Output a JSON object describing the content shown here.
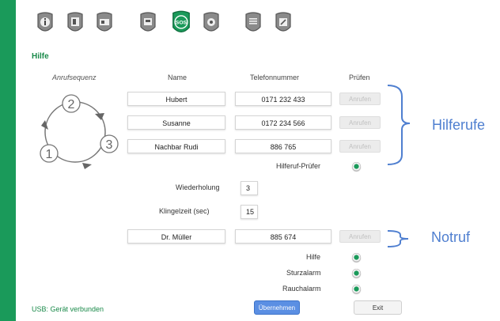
{
  "toolbar": {
    "icons": [
      "info-icon",
      "phone-book-icon",
      "radio-icon",
      "device-icon",
      "sos-icon",
      "settings-icon",
      "list-icon",
      "edit-icon"
    ],
    "sos_label": "SOS",
    "active_color": "#1a9a5a"
  },
  "page": {
    "title": "Hilfe"
  },
  "headers": {
    "sequence": "Anrufsequenz",
    "name": "Name",
    "phone": "Telefonnummer",
    "test": "Prüfen"
  },
  "sequence_nodes": [
    "2",
    "3",
    "1"
  ],
  "contacts": [
    {
      "name": "Hubert",
      "phone": "0171 232 433",
      "call": "Anrufen"
    },
    {
      "name": "Susanne",
      "phone": "0172 234 566",
      "call": "Anrufen"
    },
    {
      "name": "Nachbar Rudi",
      "phone": "886 765",
      "call": "Anrufen"
    }
  ],
  "helpcall_tester_label": "Hilferuf-Prüfer",
  "repeat": {
    "label": "Wiederholung",
    "value": "3"
  },
  "ring_time": {
    "label": "Klingelzeit (sec)",
    "value": "15"
  },
  "emergency": {
    "name": "Dr. Müller",
    "phone": "885 674",
    "call": "Anrufen"
  },
  "options": [
    {
      "label": "Hilfe"
    },
    {
      "label": "Sturzalarm"
    },
    {
      "label": "Rauchalarm"
    }
  ],
  "annotations": {
    "helpcalls": "Hilferufe",
    "emergency": "Notruf",
    "color": "#4f7fd0"
  },
  "status": "USB: Gerät verbunden",
  "buttons": {
    "apply": "Übernehmen",
    "exit": "Exit"
  }
}
